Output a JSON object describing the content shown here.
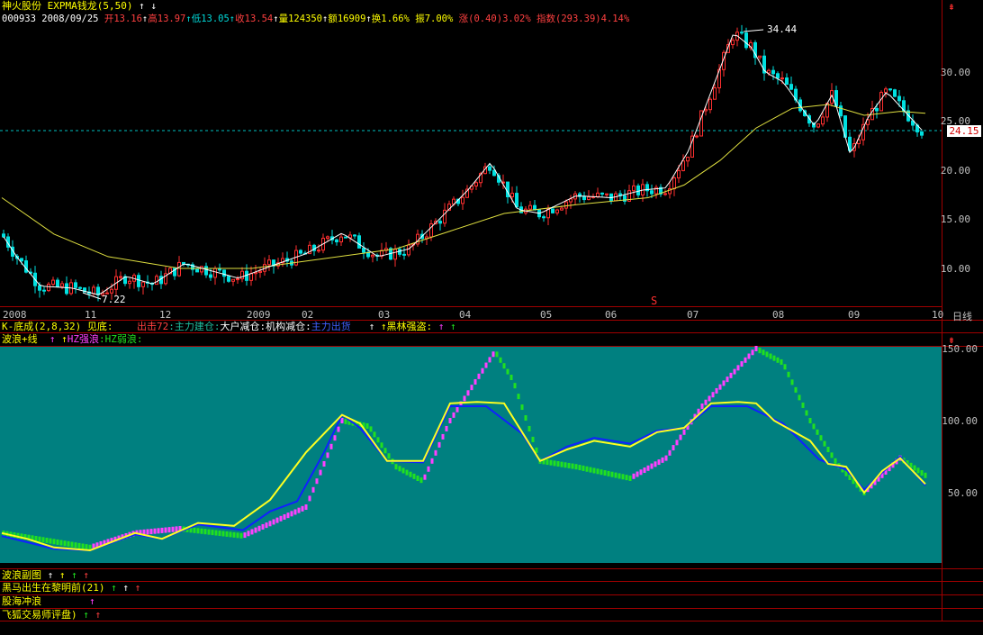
{
  "header": {
    "stock_name": "神火股份",
    "indicator": "EXPMA钱龙",
    "params": "(5,50)",
    "arrows": "↑ ↓",
    "code": "000933",
    "date": "2008/09/25",
    "open_label": "开",
    "open": "13.16",
    "high_label": "高",
    "high": "13.97",
    "low_label": "低",
    "low": "13.05",
    "close_label": "收",
    "close": "13.54",
    "volume_label": "量",
    "volume": "124350",
    "amount_label": "额",
    "amount": "16909",
    "turnover_label": "换",
    "turnover": "1.66%",
    "amplitude_label": "振",
    "amplitude": "7.00%",
    "change_label": "涨",
    "change": "(0.40)3.02%",
    "index_label": "指数",
    "index": "(293.39)4.14%"
  },
  "main_chart": {
    "high_marker": "34.44",
    "low_marker": "7.22",
    "current_price": "24.15",
    "yaxis_ticks": [
      "30.00",
      "25.00",
      "20.00",
      "15.00",
      "10.00"
    ],
    "xaxis_labels": [
      "2008",
      "11",
      "12",
      "2009",
      "02",
      "03",
      "04",
      "05",
      "06",
      "07",
      "08",
      "09",
      "10"
    ],
    "period_label": "日线",
    "s_marker": "S"
  },
  "indicator_row": {
    "name": "K-底成",
    "params": "(2,8,32)",
    "see_bottom": "见底:",
    "out72": "出击72",
    "main_build": "主力建仓",
    "big_reduce": "大户减仓",
    "inst_reduce": "机构减仓",
    "main_out": "主力出货",
    "bollinger": "黑林强盗"
  },
  "wave_row": {
    "name": "波浪+线",
    "hz_strong": "HZ强浪",
    "hz_weak": "HZ弱浪"
  },
  "wave_chart": {
    "yaxis_ticks": [
      "150.00",
      "100.00",
      "50.00"
    ]
  },
  "bottom_rows": [
    {
      "label": "波浪副图"
    },
    {
      "label": "黑马出生在黎明前(21)"
    },
    {
      "label": "股海冲浪"
    },
    {
      "label": "飞狐交易师评盘)"
    }
  ],
  "colors": {
    "background": "#000000",
    "grid": "#a00000",
    "wave_panel": "#008080",
    "up_candle": "#ff3030",
    "down_candle": "#00e0e0",
    "ma_short": "#ffffff",
    "ma_long": "#e0e040"
  }
}
